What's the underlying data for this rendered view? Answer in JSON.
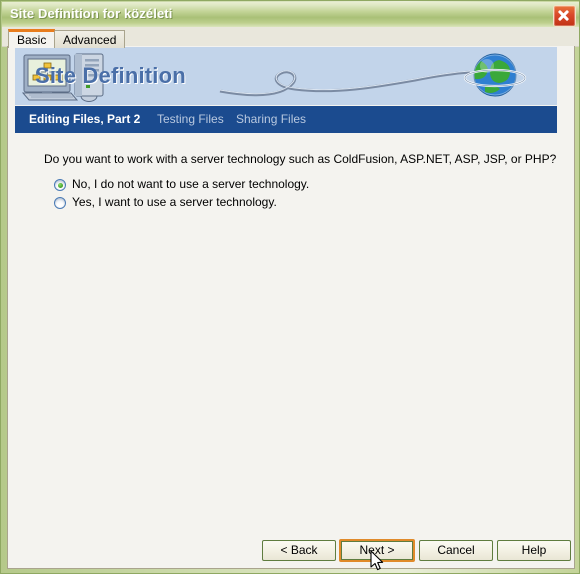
{
  "window": {
    "title": "Site Definition for közéleti",
    "close_icon": "close-icon"
  },
  "tabs": [
    {
      "label": "Basic",
      "active": true
    },
    {
      "label": "Advanced",
      "active": false
    }
  ],
  "banner": {
    "title": "Site Definition",
    "computer_icon": "computer-server-icon",
    "globe_icon": "globe-icon",
    "background_color": "#c2d4ea",
    "title_color": "#4a6fa8"
  },
  "nav": {
    "background_color": "#1b4b8f",
    "items": [
      {
        "label": "Editing Files, Part 2",
        "active": true
      },
      {
        "label": "Testing Files",
        "active": false
      },
      {
        "label": "Sharing Files",
        "active": false
      }
    ]
  },
  "content": {
    "question": "Do you want to work with a server technology such as ColdFusion, ASP.NET, ASP, JSP, or PHP?",
    "options": [
      {
        "label": "No, I do not want to use a server technology.",
        "selected": true
      },
      {
        "label": "Yes, I want to use a server technology.",
        "selected": false
      }
    ]
  },
  "buttons": {
    "back": "< Back",
    "next": "Next >",
    "cancel": "Cancel",
    "help": "Help",
    "default_accent_color": "#e08a2a"
  },
  "cursor": {
    "icon": "mouse-pointer-arrow"
  }
}
